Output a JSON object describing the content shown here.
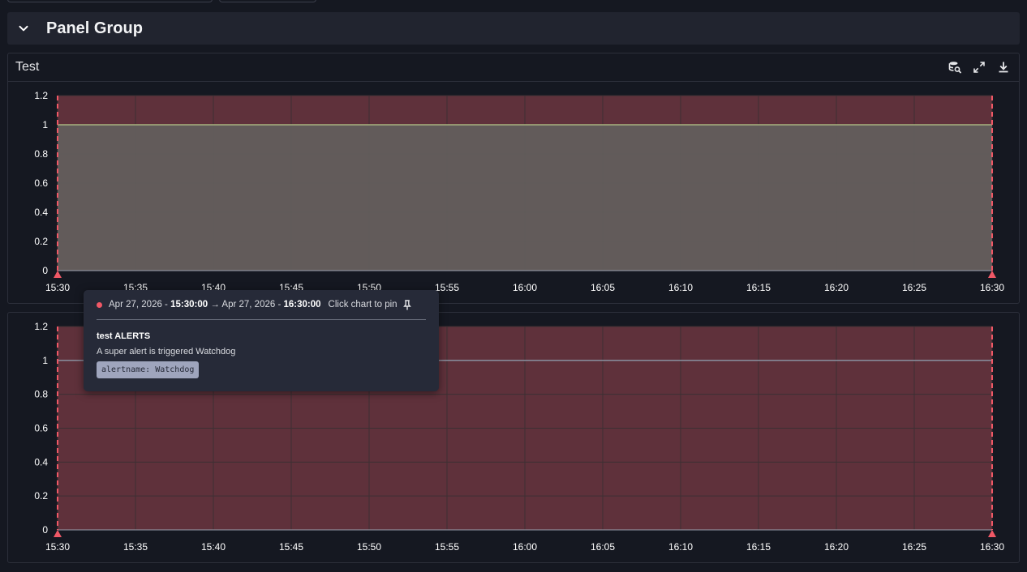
{
  "panel_group": {
    "title": "Panel Group",
    "icon": "chevron-down-icon"
  },
  "panels": [
    {
      "title": "Test",
      "actions": [
        "query-icon",
        "expand-icon",
        "download-icon"
      ]
    },
    {
      "title": ""
    }
  ],
  "tooltip": {
    "start_date": "Apr 27, 2026 -",
    "start_time": "15:30:00",
    "arrow": "→",
    "end_date": "Apr 27, 2026 -",
    "end_time": "16:30:00",
    "hint": "Click chart to pin",
    "alert_title": "test ALERTS",
    "description": "A super alert is triggered Watchdog",
    "label": "alertname: Watchdog",
    "dot_color": "#f05866"
  },
  "colors": {
    "alert_band": "#5f313b",
    "alert_line": "#f05866",
    "series_fill": "#625e5c",
    "series_line_1": "#a7b27f",
    "series_line_2": "#8e99a8",
    "grid": "#3c3033",
    "axis_text": "#ffffff"
  },
  "chart_data": [
    {
      "type": "area",
      "x": [
        "15:30",
        "15:35",
        "15:40",
        "15:45",
        "15:50",
        "15:55",
        "16:00",
        "16:05",
        "16:10",
        "16:15",
        "16:20",
        "16:25",
        "16:30"
      ],
      "ytick_labels": [
        "0",
        "0.2",
        "0.4",
        "0.6",
        "0.8",
        "1",
        "1.2"
      ],
      "ylim": [
        0,
        1.2
      ],
      "series": [
        {
          "values": [
            1,
            1,
            1,
            1,
            1,
            1,
            1,
            1,
            1,
            1,
            1,
            1,
            1
          ]
        }
      ],
      "alert_range": [
        "15:30",
        "16:30"
      ],
      "grid": true
    },
    {
      "type": "line",
      "x": [
        "15:30",
        "15:35",
        "15:40",
        "15:45",
        "15:50",
        "15:55",
        "16:00",
        "16:05",
        "16:10",
        "16:15",
        "16:20",
        "16:25",
        "16:30"
      ],
      "ytick_labels": [
        "0",
        "0.2",
        "0.4",
        "0.6",
        "0.8",
        "1",
        "1.2"
      ],
      "ylim": [
        0,
        1.2
      ],
      "series": [
        {
          "values": [
            1,
            1,
            1,
            1,
            1,
            1,
            1,
            1,
            1,
            1,
            1,
            1,
            1
          ]
        }
      ],
      "alert_range": [
        "15:30",
        "16:30"
      ],
      "grid": true
    }
  ]
}
